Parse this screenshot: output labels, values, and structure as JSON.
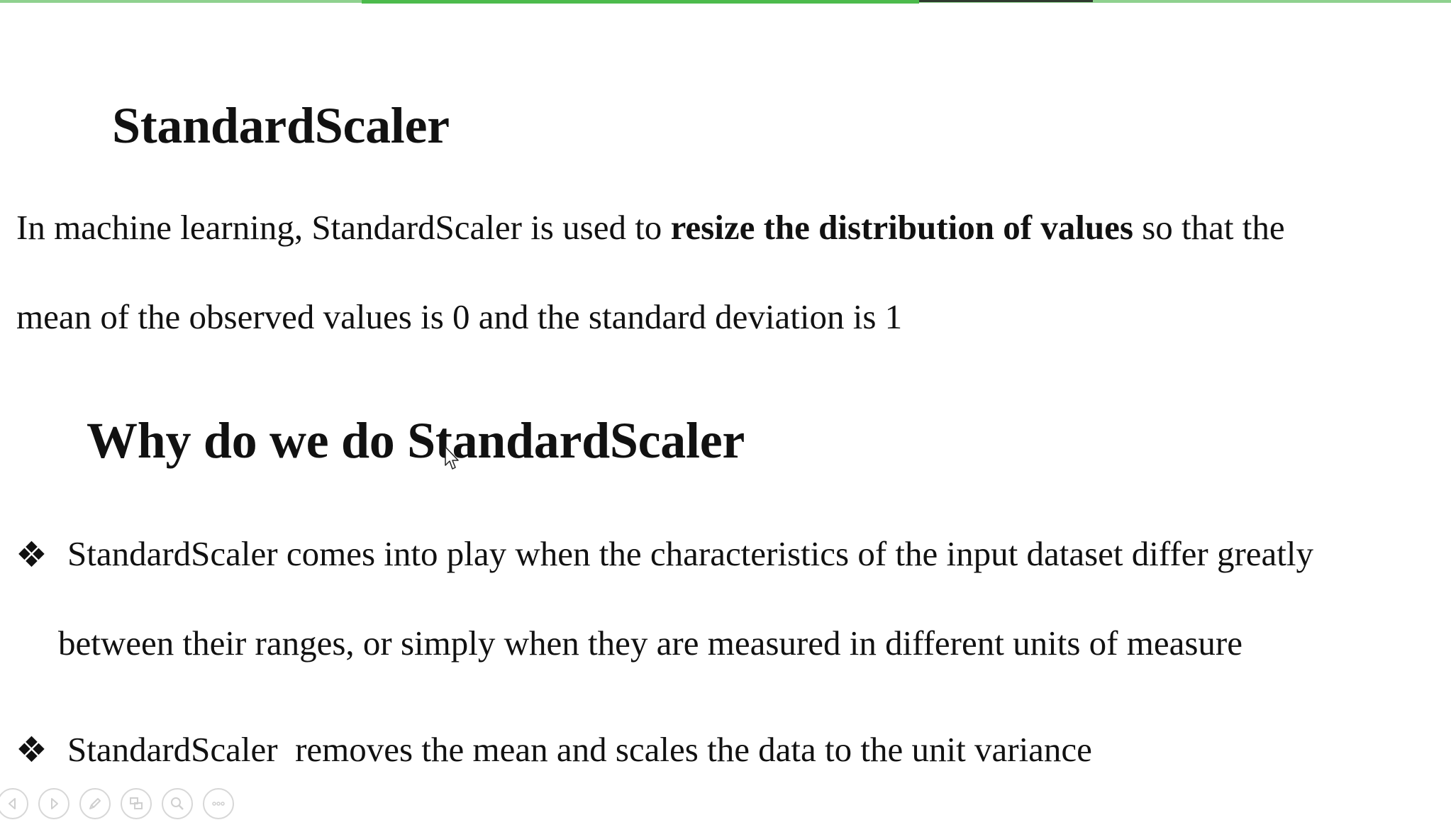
{
  "progress": {
    "played_fraction": 0.63
  },
  "slide": {
    "title": "StandardScaler",
    "definition": {
      "line1_before": "In machine learning, StandardScaler is used to ",
      "line1_bold": "resize the distribution of values",
      "line1_after": " so that the",
      "line2": "mean of the observed values is 0 and the standard deviation is 1"
    },
    "subtitle": "Why do we do StandardScaler",
    "bullets": [
      {
        "symbol": "❖",
        "line1": "StandardScaler comes into play when the characteristics of the input dataset differ greatly",
        "line2": "between their ranges, or simply when they are measured in different units of measure"
      },
      {
        "symbol": "❖",
        "line1": "StandardScaler  removes the mean and scales the data to the unit variance"
      }
    ]
  },
  "toolbar": {
    "icons": [
      "previous-icon",
      "next-icon",
      "pen-icon",
      "slides-icon",
      "zoom-icon",
      "more-icon"
    ]
  },
  "colors": {
    "progress_fill": "#4cbb4c",
    "progress_track": "#8fd18f",
    "text": "#111111",
    "toolbar_icon": "#cfcfcf"
  }
}
